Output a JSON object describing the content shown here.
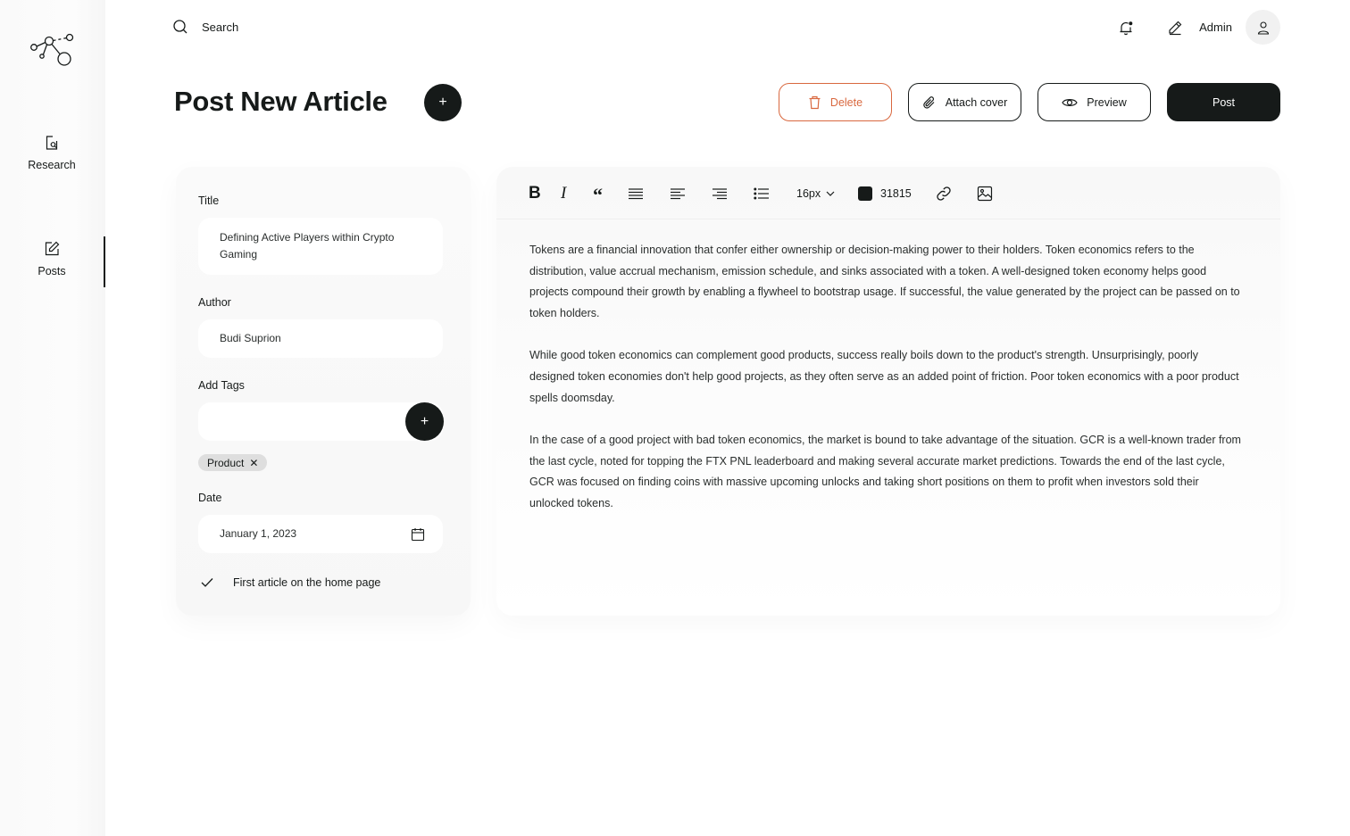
{
  "sidebar": {
    "items": [
      {
        "label": "Research",
        "icon": "research-icon"
      },
      {
        "label": "Posts",
        "icon": "posts-icon"
      }
    ],
    "active": "Posts"
  },
  "topbar": {
    "search_label": "Search",
    "user_name": "Admin"
  },
  "header": {
    "title": "Post New Article",
    "buttons": {
      "delete": "Delete",
      "attach": "Attach cover",
      "preview": "Preview",
      "post": "Post"
    }
  },
  "form": {
    "title_label": "Title",
    "title_value": "Defining Active Players within Crypto Gaming",
    "author_label": "Author",
    "author_value": "Budi Suprion",
    "tags_label": "Add Tags",
    "tags_value": "",
    "tags": [
      "Product"
    ],
    "date_label": "Date",
    "date_value": "January 1, 2023",
    "home_page_label": "First article on the home page",
    "home_page_checked": true
  },
  "editor": {
    "toolbar": {
      "bold": "B",
      "italic": "I",
      "quote": "“",
      "font_size": "16px",
      "color_code": "31815",
      "color": "#161a19"
    },
    "paragraphs": [
      "Tokens are a financial innovation that confer either ownership or decision-making power to their holders. Token economics refers to the distribution, value accrual mechanism, emission schedule, and sinks associated with a token. A well-designed token economy helps good projects compound their growth by enabling a flywheel to bootstrap usage. If successful, the value generated by the project can be passed on to token holders.",
      "While good token economics can complement good products, success really boils down to the product's strength. Unsurprisingly, poorly designed token economies don't help good projects, as they often serve as an added point of friction. Poor token economics with a poor product spells doomsday.",
      "In the case of a good project with bad token economics, the market is bound to take advantage of the situation. GCR is a well-known trader from the last cycle, noted for topping the FTX PNL leaderboard and making several accurate market predictions. Towards the end of the last cycle, GCR was focused on finding coins with massive upcoming unlocks and taking short positions on them to profit when investors sold their unlocked tokens."
    ]
  },
  "colors": {
    "primary": "#161a19",
    "danger": "#d9683f",
    "chip": "#dedede"
  }
}
